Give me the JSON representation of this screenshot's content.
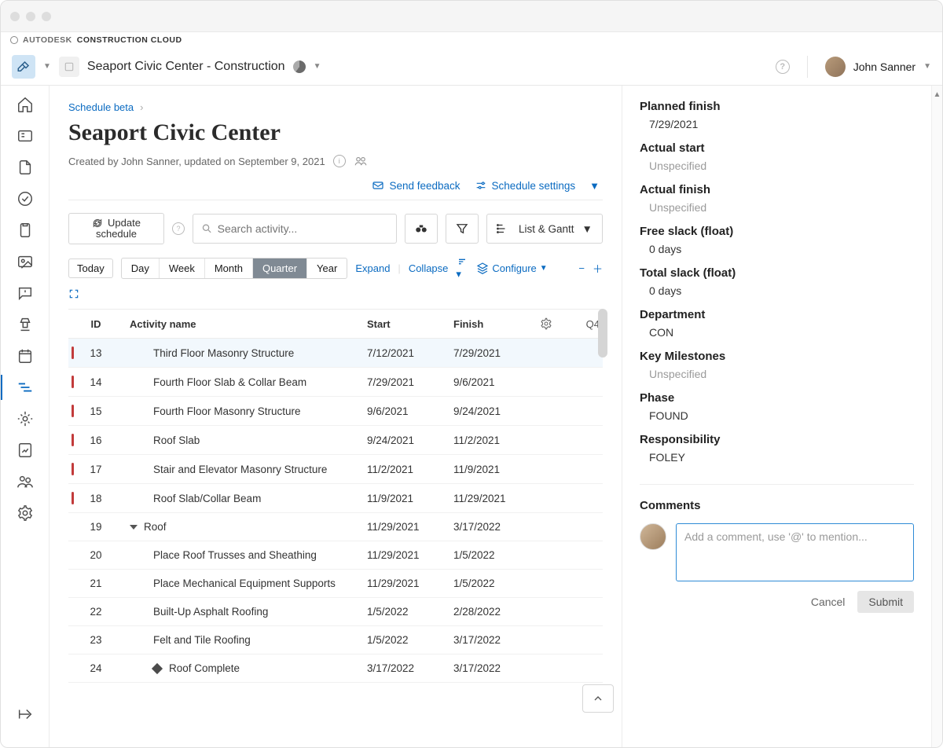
{
  "brand": {
    "name_top": "AUTODESK",
    "name_bottom": "CONSTRUCTION CLOUD"
  },
  "topbar": {
    "project_title": "Seaport Civic Center - Construction",
    "username": "John Sanner"
  },
  "breadcrumb": {
    "label": "Schedule beta"
  },
  "page": {
    "title": "Seaport Civic Center",
    "meta": "Created by John Sanner, updated on September 9, 2021"
  },
  "actions": {
    "send_feedback": "Send feedback",
    "schedule_settings": "Schedule settings"
  },
  "toolbar": {
    "update_l1": "Update",
    "update_l2": "schedule",
    "search_placeholder": "Search activity...",
    "view_label": "List & Gantt"
  },
  "filters": {
    "today": "Today",
    "day": "Day",
    "week": "Week",
    "month": "Month",
    "quarter": "Quarter",
    "year": "Year",
    "expand": "Expand",
    "collapse": "Collapse",
    "configure": "Configure"
  },
  "columns": {
    "id": "ID",
    "name": "Activity name",
    "start": "Start",
    "finish": "Finish",
    "quarter": "Q4"
  },
  "rows": [
    {
      "id": "13",
      "red": true,
      "indent": true,
      "name": "Third Floor Masonry Structure",
      "start": "7/12/2021",
      "finish": "7/29/2021",
      "highlight": true
    },
    {
      "id": "14",
      "red": true,
      "indent": true,
      "name": "Fourth Floor Slab & Collar Beam",
      "start": "7/29/2021",
      "finish": "9/6/2021"
    },
    {
      "id": "15",
      "red": true,
      "indent": true,
      "name": "Fourth Floor Masonry Structure",
      "start": "9/6/2021",
      "finish": "9/24/2021"
    },
    {
      "id": "16",
      "red": true,
      "indent": true,
      "name": "Roof Slab",
      "start": "9/24/2021",
      "finish": "11/2/2021"
    },
    {
      "id": "17",
      "red": true,
      "indent": true,
      "name": "Stair and Elevator Masonry Structure",
      "start": "11/2/2021",
      "finish": "11/9/2021"
    },
    {
      "id": "18",
      "red": true,
      "indent": true,
      "name": "Roof Slab/Collar Beam",
      "start": "11/9/2021",
      "finish": "11/29/2021"
    },
    {
      "id": "19",
      "red": false,
      "indent": false,
      "name": "Roof",
      "group": true,
      "start": "11/29/2021",
      "finish": "3/17/2022"
    },
    {
      "id": "20",
      "red": false,
      "indent": true,
      "name": "Place Roof Trusses and Sheathing",
      "start": "11/29/2021",
      "finish": "1/5/2022"
    },
    {
      "id": "21",
      "red": false,
      "indent": true,
      "name": "Place Mechanical Equipment Supports",
      "start": "11/29/2021",
      "finish": "1/5/2022"
    },
    {
      "id": "22",
      "red": false,
      "indent": true,
      "name": "Built-Up Asphalt Roofing",
      "start": "1/5/2022",
      "finish": "2/28/2022"
    },
    {
      "id": "23",
      "red": false,
      "indent": true,
      "name": "Felt and Tile Roofing",
      "start": "1/5/2022",
      "finish": "3/17/2022"
    },
    {
      "id": "24",
      "red": false,
      "indent": true,
      "name": "Roof Complete",
      "milestone": true,
      "start": "3/17/2022",
      "finish": "3/17/2022"
    }
  ],
  "details": {
    "planned_finish": {
      "label": "Planned finish",
      "value": "7/29/2021"
    },
    "actual_start": {
      "label": "Actual start",
      "value": "Unspecified",
      "muted": true
    },
    "actual_finish": {
      "label": "Actual finish",
      "value": "Unspecified",
      "muted": true
    },
    "free_slack": {
      "label": "Free slack (float)",
      "value": "0 days"
    },
    "total_slack": {
      "label": "Total slack (float)",
      "value": "0 days"
    },
    "department": {
      "label": "Department",
      "value": "CON"
    },
    "key_milestones": {
      "label": "Key Milestones",
      "value": "Unspecified",
      "muted": true
    },
    "phase": {
      "label": "Phase",
      "value": "FOUND"
    },
    "responsibility": {
      "label": "Responsibility",
      "value": "FOLEY"
    }
  },
  "comments": {
    "heading": "Comments",
    "placeholder": "Add a comment, use '@' to mention...",
    "cancel": "Cancel",
    "submit": "Submit"
  }
}
